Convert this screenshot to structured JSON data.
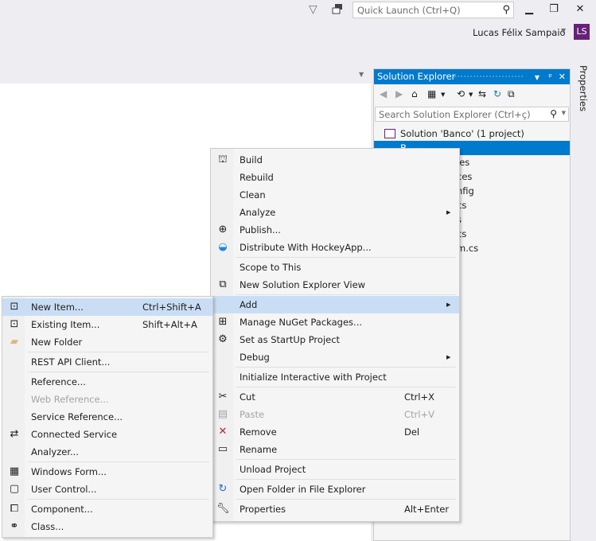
{
  "titlebar": {
    "quick_launch_placeholder": "Quick Launch (Ctrl+Q)",
    "user_name": "Lucas Félix Sampaio",
    "avatar_initials": "LS",
    "avatar_color": "#68217a"
  },
  "solution_explorer": {
    "title": "Solution Explorer",
    "search_placeholder": "Search Solution Explorer (Ctrl+ç)",
    "accent_color": "#007acc",
    "tree": [
      {
        "label": "Solution 'Banco' (1 project)",
        "selected": false
      },
      {
        "label": "B…",
        "selected": true
      },
      {
        "label": "ies",
        "selected": false
      },
      {
        "label": "ces",
        "selected": false
      },
      {
        "label": "nfig",
        "selected": false
      },
      {
        "label": "cs",
        "selected": false
      },
      {
        "label": "s",
        "selected": false
      },
      {
        "label": "cs",
        "selected": false
      },
      {
        "label": "m.cs",
        "selected": false
      }
    ]
  },
  "properties_tab": "Properties",
  "context_menu": {
    "items": [
      {
        "label": "Build",
        "icon": "build-icon"
      },
      {
        "label": "Rebuild"
      },
      {
        "label": "Clean"
      },
      {
        "label": "Analyze",
        "submenu": true
      },
      {
        "label": "Publish...",
        "icon": "globe-icon"
      },
      {
        "label": "Distribute With HockeyApp...",
        "icon": "hockeyapp-icon"
      },
      {
        "label": "Scope to This"
      },
      {
        "label": "New Solution Explorer View",
        "icon": "new-view-icon"
      },
      {
        "label": "Add",
        "submenu": true,
        "highlighted": true
      },
      {
        "label": "Manage NuGet Packages...",
        "icon": "nuget-icon"
      },
      {
        "label": "Set as StartUp Project",
        "icon": "gear-icon"
      },
      {
        "label": "Debug",
        "submenu": true
      },
      {
        "label": "Initialize Interactive with Project"
      },
      {
        "label": "Cut",
        "shortcut": "Ctrl+X",
        "icon": "scissors-icon"
      },
      {
        "label": "Paste",
        "shortcut": "Ctrl+V",
        "disabled": true,
        "icon": "paste-icon"
      },
      {
        "label": "Remove",
        "shortcut": "Del",
        "icon": "remove-icon"
      },
      {
        "label": "Rename",
        "icon": "rename-icon"
      },
      {
        "label": "Unload Project"
      },
      {
        "label": "Open Folder in File Explorer",
        "icon": "refresh-folder-icon"
      },
      {
        "label": "Properties",
        "shortcut": "Alt+Enter",
        "icon": "wrench-icon"
      }
    ]
  },
  "add_submenu": {
    "items": [
      {
        "label": "New Item...",
        "shortcut": "Ctrl+Shift+A",
        "highlighted": true,
        "icon": "new-item-icon"
      },
      {
        "label": "Existing Item...",
        "shortcut": "Shift+Alt+A",
        "icon": "existing-item-icon"
      },
      {
        "label": "New Folder",
        "icon": "folder-icon"
      },
      {
        "label": "REST API Client..."
      },
      {
        "label": "Reference..."
      },
      {
        "label": "Web Reference...",
        "disabled": true
      },
      {
        "label": "Service Reference..."
      },
      {
        "label": "Connected Service",
        "icon": "connected-service-icon"
      },
      {
        "label": "Analyzer..."
      },
      {
        "label": "Windows Form...",
        "icon": "windows-form-icon"
      },
      {
        "label": "User Control...",
        "icon": "user-control-icon"
      },
      {
        "label": "Component...",
        "icon": "component-icon"
      },
      {
        "label": "Class...",
        "icon": "class-icon"
      }
    ]
  }
}
